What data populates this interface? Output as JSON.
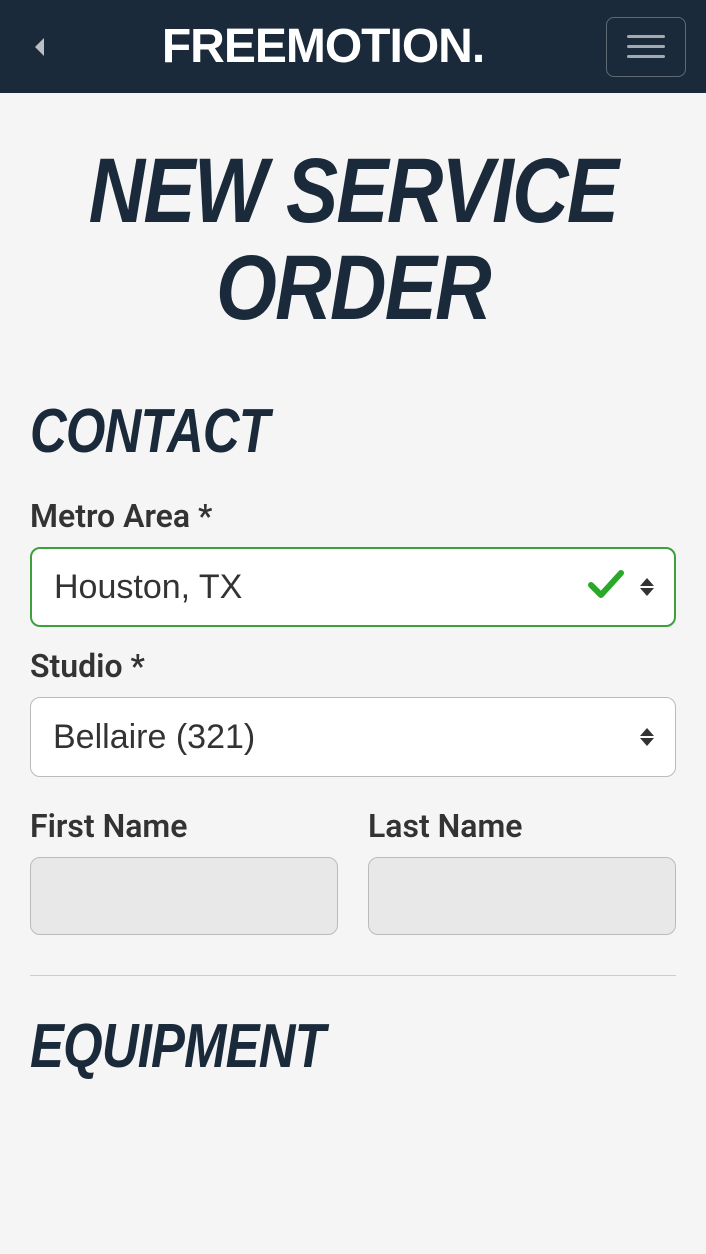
{
  "navbar": {
    "logo_text": "FREEMOTION."
  },
  "page": {
    "title": "NEW SERVICE ORDER"
  },
  "sections": {
    "contact": {
      "heading": "CONTACT",
      "metro_label": "Metro Area *",
      "metro_value": "Houston, TX",
      "studio_label": "Studio *",
      "studio_value": "Bellaire (321)",
      "first_name_label": "First Name",
      "first_name_value": "",
      "last_name_label": "Last Name",
      "last_name_value": ""
    },
    "equipment": {
      "heading": "EQUIPMENT"
    }
  }
}
